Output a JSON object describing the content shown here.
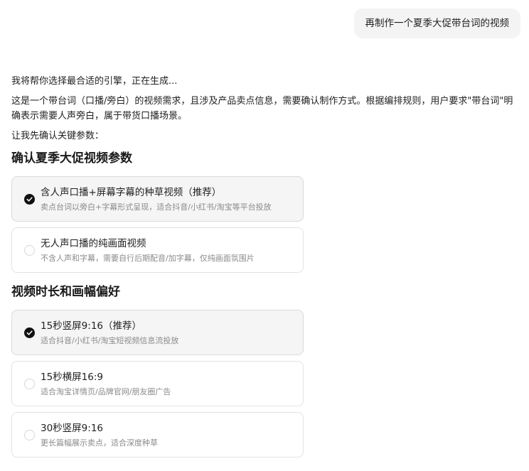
{
  "user_message": "再制作一个夏季大促带台词的视频",
  "assistant": {
    "intro": "我将帮你选择最合适的引擎，正在生成...",
    "analysis": "这是一个带台词（口播/旁白）的视频需求，且涉及产品卖点信息，需要确认制作方式。根据编排规则，用户要求\"带台词\"明确表示需要人声旁白，属于带货口播场景。",
    "confirm_prompt": "让我先确认关键参数："
  },
  "section1": {
    "title": "确认夏季大促视频参数",
    "options": [
      {
        "title": "含人声口播+屏幕字幕的种草视频（推荐）",
        "desc": "卖点台词以旁白+字幕形式呈现，适合抖音/小红书/淘宝等平台投放",
        "selected": true
      },
      {
        "title": "无人声口播的纯画面视频",
        "desc": "不含人声和字幕，需要自行后期配音/加字幕，仅纯画面氛围片",
        "selected": false
      }
    ]
  },
  "section2": {
    "title": "视频时长和画幅偏好",
    "options": [
      {
        "title": "15秒竖屏9:16（推荐）",
        "desc": "适合抖音/小红书/淘宝短视频信息流投放",
        "selected": true
      },
      {
        "title": "15秒横屏16:9",
        "desc": "适合淘宝详情页/品牌官网/朋友圈广告",
        "selected": false
      },
      {
        "title": "30秒竖屏9:16",
        "desc": "更长篇幅展示卖点，适合深度种草",
        "selected": false
      }
    ]
  }
}
